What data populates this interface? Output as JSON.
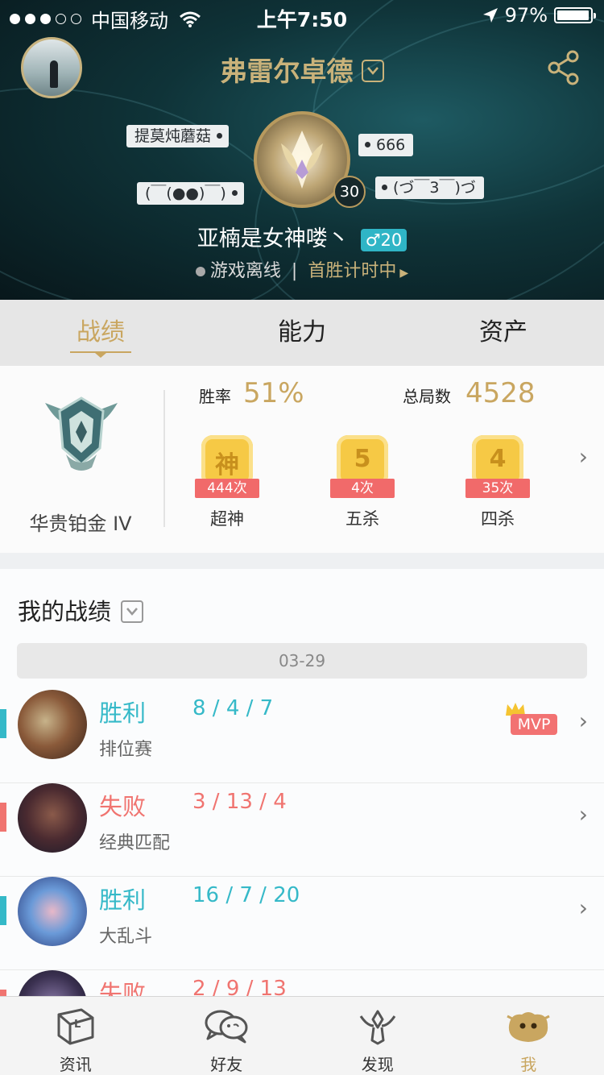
{
  "status_bar": {
    "carrier": "中国移动",
    "time": "上午7:50",
    "battery": "97%",
    "battery_level": 0.97
  },
  "header": {
    "title": "弗雷尔卓德",
    "tags": [
      "提莫炖蘑菇",
      "666",
      "(￣(●●)￣)",
      "(づ￣3￣)づ"
    ],
    "level": "30",
    "player_name": "亚楠是女神喽丶",
    "gender_badge": "♂20",
    "status": "游戏离线",
    "separator": "|",
    "first_win": "首胜计时中"
  },
  "tabs": [
    {
      "label": "战绩",
      "active": true
    },
    {
      "label": "能力",
      "active": false
    },
    {
      "label": "资产",
      "active": false
    }
  ],
  "stats": {
    "rank_name": "华贵铂金 IV",
    "winrate_label": "胜率",
    "winrate": "51%",
    "total_label": "总局数",
    "total": "4528",
    "achievements": [
      {
        "icon_char": "神",
        "count": "444次",
        "label": "超神"
      },
      {
        "icon_char": "5",
        "count": "4次",
        "label": "五杀"
      },
      {
        "icon_char": "4",
        "count": "35次",
        "label": "四杀"
      }
    ]
  },
  "records": {
    "title": "我的战绩",
    "date": "03-29",
    "matches": [
      {
        "result": "胜利",
        "kda": "8 / 4 / 7",
        "mode": "排位赛",
        "win": true,
        "mvp": "MVP"
      },
      {
        "result": "失败",
        "kda": "3 / 13 / 4",
        "mode": "经典匹配",
        "win": false
      },
      {
        "result": "胜利",
        "kda": "16 / 7 / 20",
        "mode": "大乱斗",
        "win": true
      },
      {
        "result": "失败",
        "kda": "2 / 9 / 13",
        "mode": "",
        "win": false
      }
    ]
  },
  "bottom_nav": [
    {
      "label": "资讯",
      "icon": "book-icon"
    },
    {
      "label": "好友",
      "icon": "chat-bubbles-icon"
    },
    {
      "label": "发现",
      "icon": "discover-icon"
    },
    {
      "label": "我",
      "icon": "poro-icon",
      "active": true
    }
  ],
  "colors": {
    "gold": "#c9a660",
    "win": "#35b9c8",
    "lose": "#f07470"
  }
}
